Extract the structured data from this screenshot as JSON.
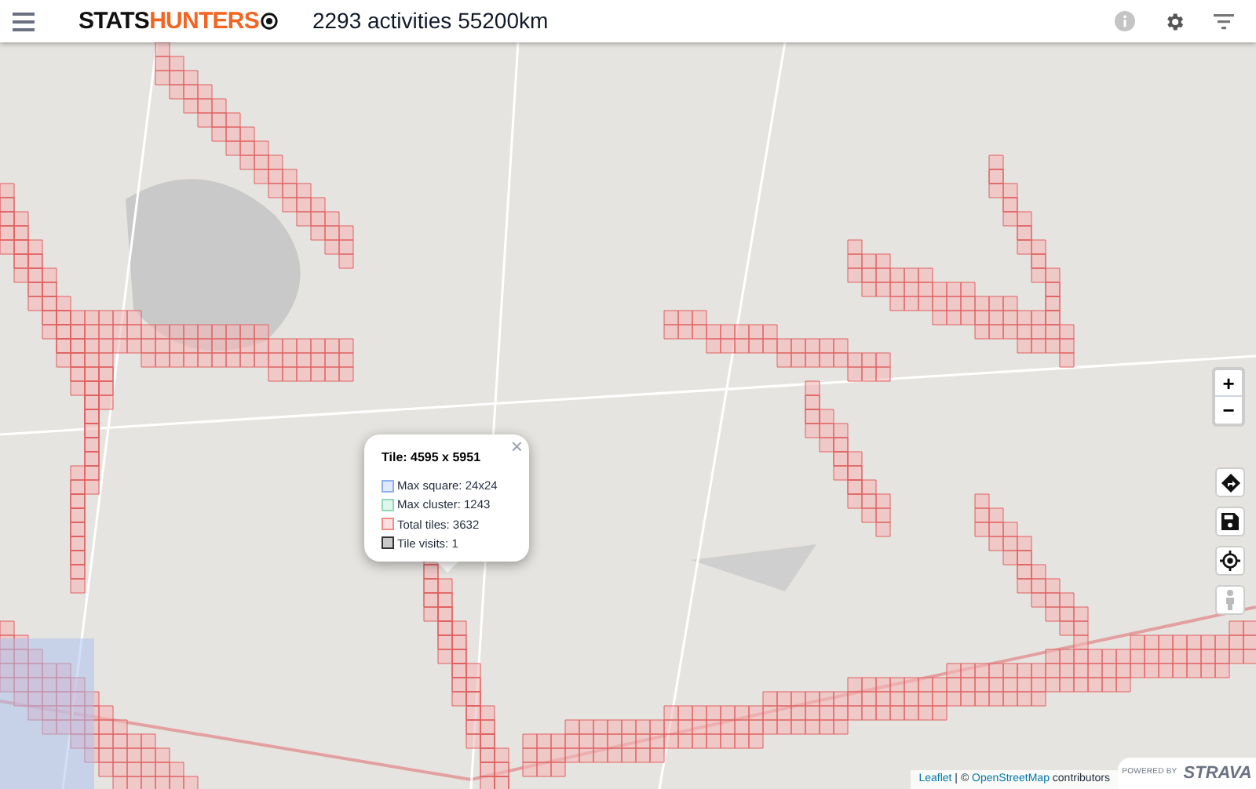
{
  "header": {
    "logo": [
      {
        "text": "STATS",
        "color": "#111111"
      },
      {
        "text": "HUNTERS",
        "color": "#f26522"
      }
    ],
    "summary": "2293 activities 55200km"
  },
  "popup": {
    "close": "×",
    "title": "Tile: 4595 x 5951",
    "legend": [
      {
        "label": "Max square: 24x24",
        "color": "#8fb0f0"
      },
      {
        "label": "Max cluster: 1243",
        "color": "#8fd8b8"
      },
      {
        "label": "Total tiles: 3632",
        "color": "#f08a8a"
      },
      {
        "label": "Tile visits: 1",
        "color": "#333333"
      }
    ]
  },
  "zoom": {
    "in": "+",
    "out": "−"
  },
  "attribution": {
    "parts": [
      {
        "kind": "link",
        "text": "Leaflet"
      },
      {
        "kind": "text",
        "text": " | © "
      },
      {
        "kind": "link",
        "text": "OpenStreetMap"
      },
      {
        "kind": "text",
        "text": " contributors"
      }
    ]
  },
  "strava": {
    "prefix": "POWERED BY",
    "brand": "STRAVA"
  }
}
